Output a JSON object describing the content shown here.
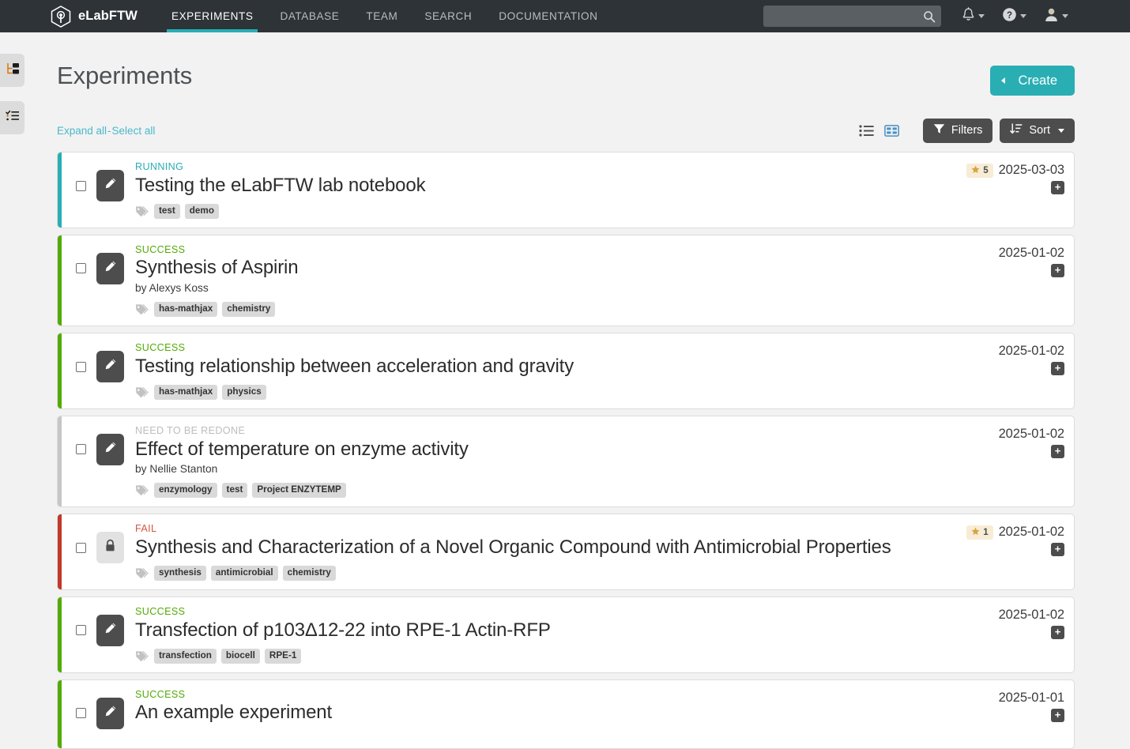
{
  "navbar": {
    "brand": "eLabFTW",
    "links": [
      {
        "label": "EXPERIMENTS",
        "active": true
      },
      {
        "label": "DATABASE",
        "active": false
      },
      {
        "label": "TEAM",
        "active": false
      },
      {
        "label": "SEARCH",
        "active": false
      },
      {
        "label": "DOCUMENTATION",
        "active": false
      }
    ],
    "search": {
      "value": "",
      "placeholder": ""
    },
    "icons": [
      "bell-icon",
      "help-icon",
      "user-icon"
    ],
    "accent_color": "#29aeb4",
    "background_color": "#2e3338"
  },
  "edge_tabs": [
    {
      "name": "sidebar-toggle-tree",
      "icon": "folder-tree-icon"
    },
    {
      "name": "sidebar-toggle-todo",
      "icon": "task-list-icon"
    }
  ],
  "page": {
    "title": "Experiments",
    "create_label": "Create"
  },
  "toolbar": {
    "expand_all": "Expand all",
    "separator": "-",
    "select_all": "Select all",
    "view_list_icon": "list-view-icon",
    "view_grid_icon": "grid-view-icon",
    "filters_label": "Filters",
    "sort_label": "Sort"
  },
  "status_colors": {
    "running": "#29aeb4",
    "success": "#54aa08",
    "need_redone": "#c6c6c6",
    "fail": "#c0392b"
  },
  "experiments": [
    {
      "status": "RUNNING",
      "status_color": "#29aeb4",
      "status_text_color": "#29aeb4",
      "bar_color": "#29aeb4",
      "title": "Testing the eLabFTW lab notebook",
      "author": "",
      "tags": [
        "test",
        "demo"
      ],
      "rating": "5",
      "date": "2025-03-03",
      "locked": false,
      "plus_label": "+"
    },
    {
      "status": "SUCCESS",
      "status_color": "#54aa08",
      "status_text_color": "#54aa08",
      "bar_color": "#54aa08",
      "title": "Synthesis of Aspirin",
      "author": "by Alexys Koss",
      "tags": [
        "has-mathjax",
        "chemistry"
      ],
      "rating": "",
      "date": "2025-01-02",
      "locked": false,
      "plus_label": "+"
    },
    {
      "status": "SUCCESS",
      "status_color": "#54aa08",
      "status_text_color": "#54aa08",
      "bar_color": "#54aa08",
      "title": "Testing relationship between acceleration and gravity",
      "author": "",
      "tags": [
        "has-mathjax",
        "physics"
      ],
      "rating": "",
      "date": "2025-01-02",
      "locked": false,
      "plus_label": "+"
    },
    {
      "status": "NEED TO BE REDONE",
      "status_color": "#c6c6c6",
      "status_text_color": "#bdbdbd",
      "bar_color": "#c6c6c6",
      "title": "Effect of temperature on enzyme activity",
      "author": "by Nellie Stanton",
      "tags": [
        "enzymology",
        "test",
        "Project ENZYTEMP"
      ],
      "rating": "",
      "date": "2025-01-02",
      "locked": false,
      "plus_label": "+"
    },
    {
      "status": "FAIL",
      "status_color": "#c0392b",
      "status_text_color": "#d3563f",
      "bar_color": "#c0392b",
      "title": "Synthesis and Characterization of a Novel Organic Compound with Antimicrobial Properties",
      "author": "",
      "tags": [
        "synthesis",
        "antimicrobial",
        "chemistry"
      ],
      "rating": "1",
      "date": "2025-01-02",
      "locked": true,
      "plus_label": "+"
    },
    {
      "status": "SUCCESS",
      "status_color": "#54aa08",
      "status_text_color": "#54aa08",
      "bar_color": "#54aa08",
      "title": "Transfection of p103Δ12-22 into RPE-1 Actin-RFP",
      "author": "",
      "tags": [
        "transfection",
        "biocell",
        "RPE-1"
      ],
      "rating": "",
      "date": "2025-01-02",
      "locked": false,
      "plus_label": "+"
    },
    {
      "status": "SUCCESS",
      "status_color": "#54aa08",
      "status_text_color": "#54aa08",
      "bar_color": "#54aa08",
      "title": "An example experiment",
      "author": "",
      "tags": [],
      "rating": "",
      "date": "2025-01-01",
      "locked": false,
      "plus_label": "+"
    }
  ]
}
